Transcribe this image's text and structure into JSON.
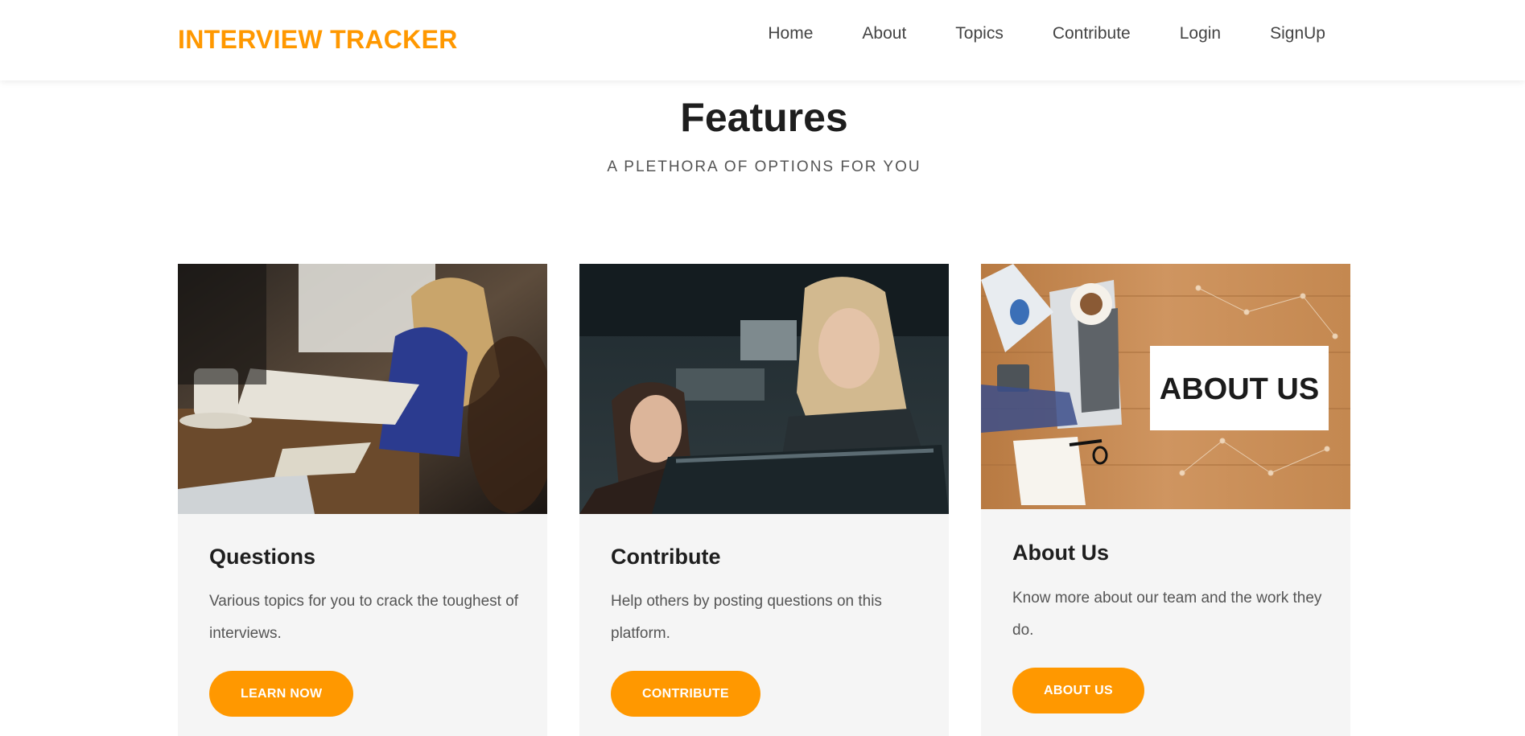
{
  "brand": "INTERVIEW TRACKER",
  "nav": [
    "Home",
    "About",
    "Topics",
    "Contribute",
    "Login",
    "SignUp"
  ],
  "features": {
    "title": "Features",
    "subtitle": "A PLETHORA OF OPTIONS FOR YOU"
  },
  "cards": [
    {
      "title": "Questions",
      "text": "Various topics for you to crack the toughest of interviews.",
      "button": "LEARN NOW",
      "image": "people-writing-notes-photo"
    },
    {
      "title": "Contribute",
      "text": "Help others by posting questions on this platform.",
      "button": "CONTRIBUTE",
      "image": "women-at-computer-photo"
    },
    {
      "title": "About Us",
      "text": "Know more about our team and the work they do.",
      "button": "ABOUT US",
      "image": "about-us-desk-photo",
      "image_caption": "ABOUT US"
    }
  ],
  "colors": {
    "accent": "#ff9800",
    "card_bg": "#f5f5f5",
    "heading": "#1e1e1e"
  }
}
